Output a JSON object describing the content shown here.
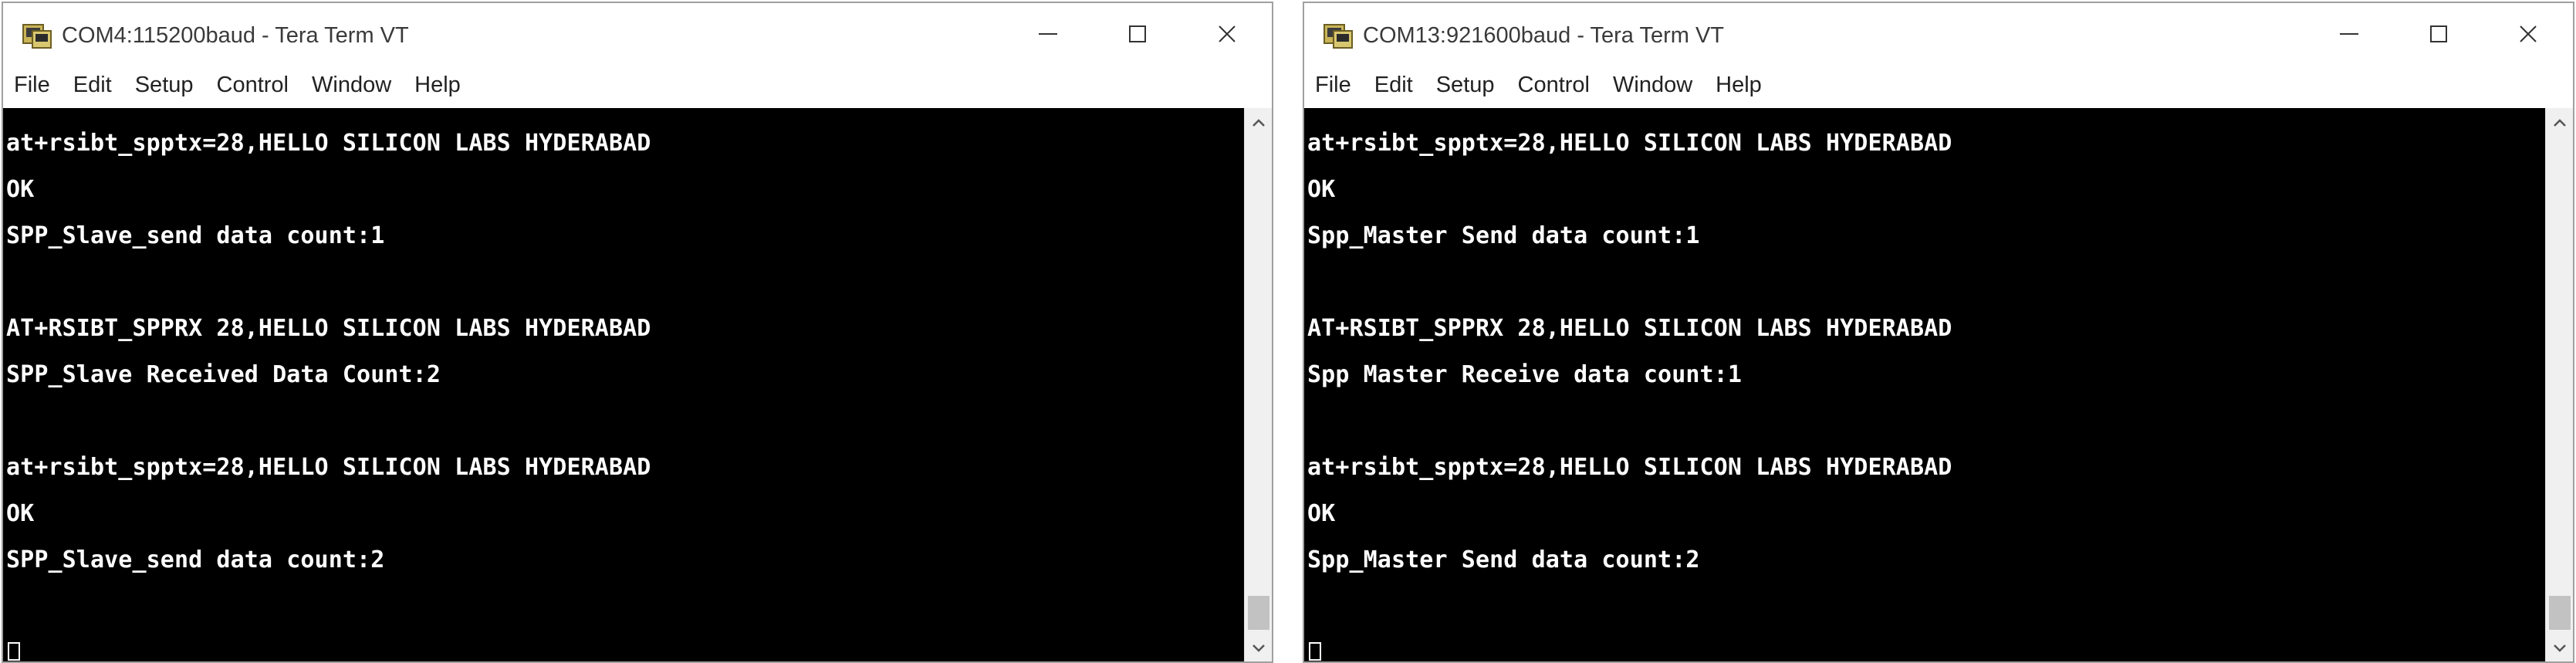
{
  "windows": [
    {
      "title": "COM4:115200baud - Tera Term VT",
      "menu": [
        "File",
        "Edit",
        "Setup",
        "Control",
        "Window",
        "Help"
      ],
      "lines": [
        "at+rsibt_spptx=28,HELLO SILICON LABS HYDERABAD",
        "OK",
        "SPP_Slave_send data count:1",
        "",
        "AT+RSIBT_SPPRX 28,HELLO SILICON LABS HYDERABAD",
        "SPP_Slave Received Data Count:2",
        "",
        "at+rsibt_spptx=28,HELLO SILICON LABS HYDERABAD",
        "OK",
        "SPP_Slave_send data count:2"
      ]
    },
    {
      "title": "COM13:921600baud - Tera Term VT",
      "menu": [
        "File",
        "Edit",
        "Setup",
        "Control",
        "Window",
        "Help"
      ],
      "lines": [
        "at+rsibt_spptx=28,HELLO SILICON LABS HYDERABAD",
        "OK",
        "Spp_Master Send data count:1",
        "",
        "AT+RSIBT_SPPRX 28,HELLO SILICON LABS HYDERABAD",
        "Spp Master Receive data count:1",
        "",
        "at+rsibt_spptx=28,HELLO SILICON LABS HYDERABAD",
        "OK",
        "Spp_Master Send data count:2"
      ]
    }
  ],
  "icons": {
    "app": "tera-term-icon",
    "minimize": "minimize-icon",
    "maximize": "maximize-icon",
    "close": "close-icon",
    "scroll_up": "scroll-up-arrow-icon",
    "scroll_down": "scroll-down-arrow-icon"
  },
  "colors": {
    "terminal_background": "#000000",
    "terminal_text": "#ffffff",
    "titlebar_background": "#ffffff"
  }
}
